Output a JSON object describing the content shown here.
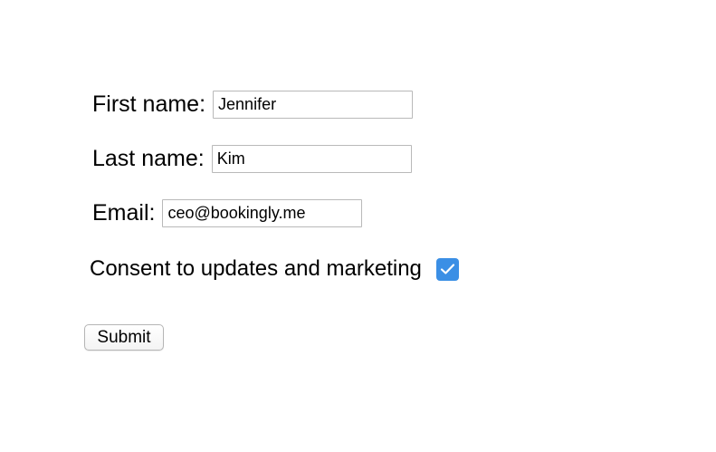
{
  "form": {
    "first_name": {
      "label": "First name:",
      "value": "Jennifer"
    },
    "last_name": {
      "label": "Last name:",
      "value": "Kim"
    },
    "email": {
      "label": "Email:",
      "value": "ceo@bookingly.me"
    },
    "consent": {
      "label": "Consent to updates and marketing",
      "checked": true,
      "icon": "checkmark-icon"
    },
    "submit_label": "Submit"
  },
  "colors": {
    "checkbox_fill": "#3b8fe5",
    "input_border": "#b9b9b9",
    "text": "#000000"
  }
}
